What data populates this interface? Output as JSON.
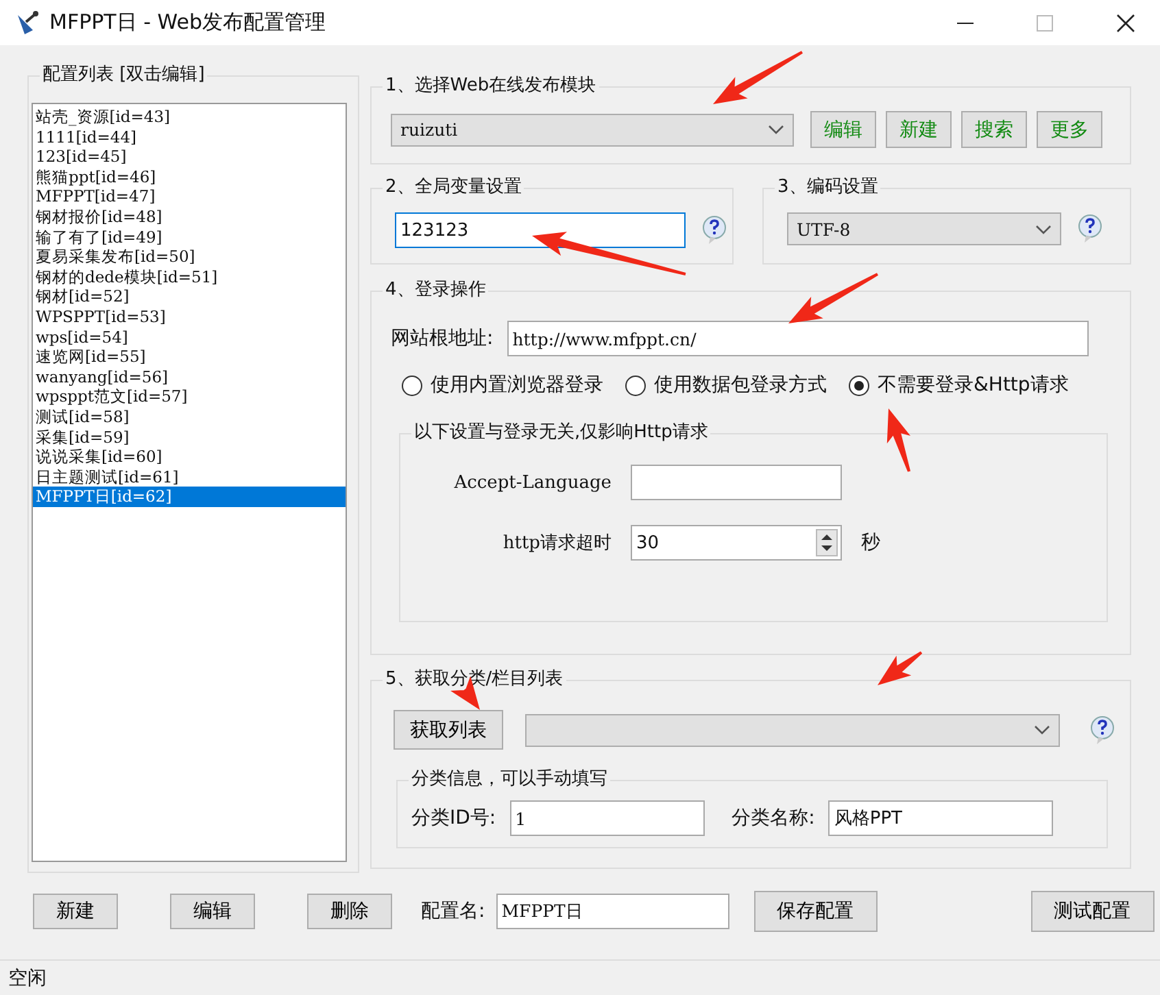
{
  "window": {
    "title": "MFPPT日 - Web发布配置管理"
  },
  "config_list": {
    "title": "配置列表  [双击编辑]",
    "items": [
      {
        "label": "站壳_资源[id=43]",
        "selected": false
      },
      {
        "label": "1111[id=44]",
        "selected": false
      },
      {
        "label": "123[id=45]",
        "selected": false
      },
      {
        "label": "熊猫ppt[id=46]",
        "selected": false
      },
      {
        "label": "MFPPT[id=47]",
        "selected": false
      },
      {
        "label": "钢材报价[id=48]",
        "selected": false
      },
      {
        "label": "输了有了[id=49]",
        "selected": false
      },
      {
        "label": "夏易采集发布[id=50]",
        "selected": false
      },
      {
        "label": "钢材的dede模块[id=51]",
        "selected": false
      },
      {
        "label": "钢材[id=52]",
        "selected": false
      },
      {
        "label": "WPSPPT[id=53]",
        "selected": false
      },
      {
        "label": "wps[id=54]",
        "selected": false
      },
      {
        "label": "速览网[id=55]",
        "selected": false
      },
      {
        "label": "wanyang[id=56]",
        "selected": false
      },
      {
        "label": "wpsppt范文[id=57]",
        "selected": false
      },
      {
        "label": "测试[id=58]",
        "selected": false
      },
      {
        "label": "采集[id=59]",
        "selected": false
      },
      {
        "label": "说说采集[id=60]",
        "selected": false
      },
      {
        "label": "日主题测试[id=61]",
        "selected": false
      },
      {
        "label": "MFPPT日[id=62]",
        "selected": true
      }
    ]
  },
  "module_section": {
    "title": "1、选择Web在线发布模块",
    "module": "ruizuti",
    "buttons": [
      "编辑",
      "新建",
      "搜索",
      "更多"
    ]
  },
  "global_vars": {
    "title": "2、全局变量设置",
    "value": "123123"
  },
  "encoding": {
    "title": "3、编码设置",
    "value": "UTF-8"
  },
  "login": {
    "title": "4、登录操作",
    "root_label": "网站根地址:",
    "root_url": "http://www.mfppt.cn/",
    "options": [
      {
        "label": "使用内置浏览器登录",
        "selected": false
      },
      {
        "label": "使用数据包登录方式",
        "selected": false
      },
      {
        "label": "不需要登录&Http请求",
        "selected": true
      }
    ],
    "http": {
      "title": "以下设置与登录无关,仅影响Http请求",
      "language_label": "Accept-Language",
      "timeout_label": "http请求超时",
      "timeout": "30",
      "unit": "秒"
    }
  },
  "category": {
    "title": "5、获取分类/栏目列表",
    "fetch_button": "获取列表",
    "info": {
      "title": "分类信息，可以手动填写",
      "id_label": "分类ID号:",
      "id": "1",
      "name_label": "分类名称:",
      "name": "风格PPT"
    }
  },
  "list_buttons": [
    "新建",
    "编辑",
    "删除"
  ],
  "config_name": {
    "label": "配置名:",
    "value": "MFPPT日"
  },
  "save_button": "保存配置",
  "test_button": "测试配置",
  "status_bar": "空闲"
}
